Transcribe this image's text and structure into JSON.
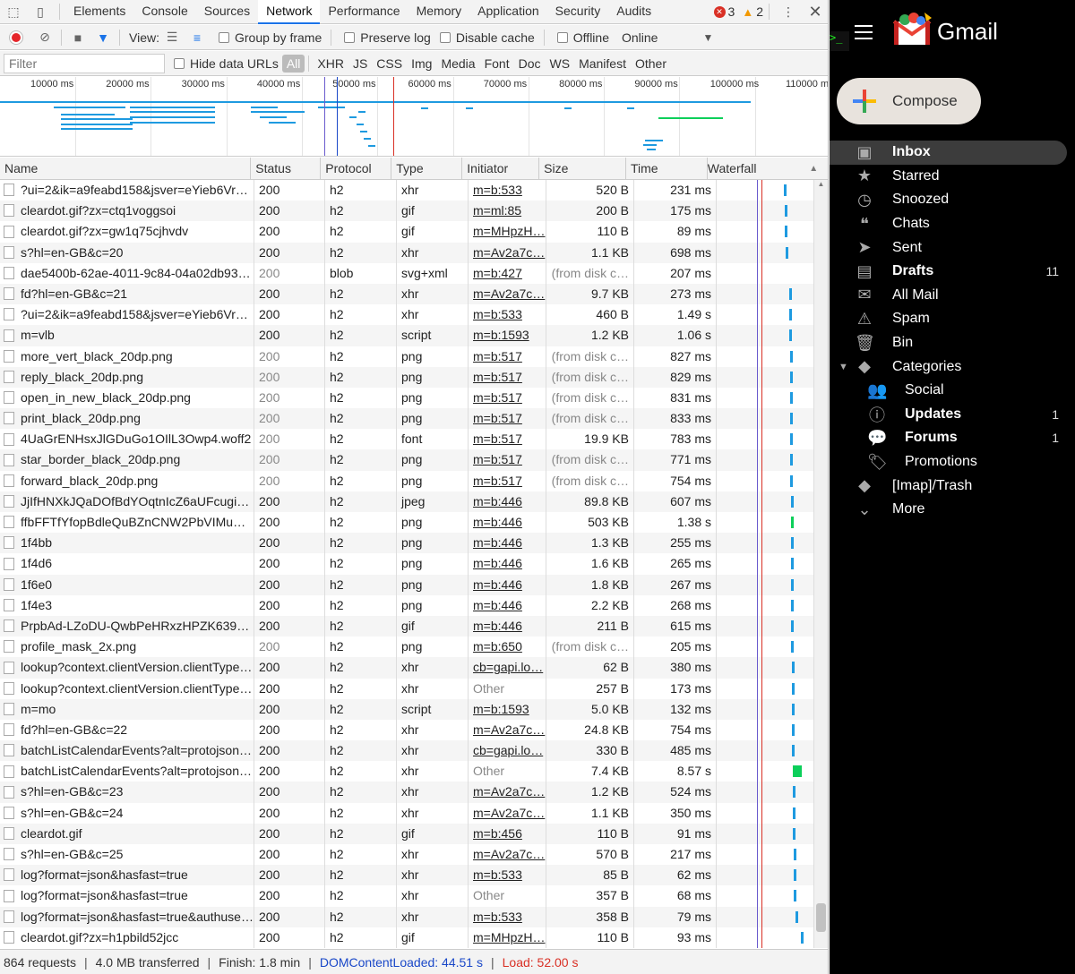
{
  "devtools": {
    "tabs": [
      "Elements",
      "Console",
      "Sources",
      "Network",
      "Performance",
      "Memory",
      "Application",
      "Security",
      "Audits"
    ],
    "active_tab": "Network",
    "error_count": "3",
    "warning_count": "2",
    "toolbar": {
      "view_label": "View:",
      "group_by_frame": "Group by frame",
      "preserve_log": "Preserve log",
      "disable_cache": "Disable cache",
      "offline": "Offline",
      "throttle": "Online"
    },
    "filter": {
      "placeholder": "Filter",
      "hide_data_urls": "Hide data URLs",
      "types": [
        "All",
        "XHR",
        "JS",
        "CSS",
        "Img",
        "Media",
        "Font",
        "Doc",
        "WS",
        "Manifest",
        "Other"
      ],
      "active_type": "All"
    },
    "overview_ticks": [
      "10000 ms",
      "20000 ms",
      "30000 ms",
      "40000 ms",
      "50000 ms",
      "60000 ms",
      "70000 ms",
      "80000 ms",
      "90000 ms",
      "100000 ms",
      "110000 m"
    ],
    "columns": [
      "Name",
      "Status",
      "Protocol",
      "Type",
      "Initiator",
      "Size",
      "Time",
      "Waterfall"
    ],
    "rows": [
      {
        "name": "?ui=2&ik=a9feabd158&jsver=eYieb6VrL…",
        "status": "200",
        "protocol": "h2",
        "type": "xhr",
        "initiator": "m=b:533",
        "size": "520 B",
        "time": "231 ms",
        "wf": 0.7,
        "dim": false
      },
      {
        "name": "cleardot.gif?zx=ctq1voggsoi",
        "status": "200",
        "protocol": "h2",
        "type": "gif",
        "initiator": "m=ml:85",
        "size": "200 B",
        "time": "175 ms",
        "wf": 0.71,
        "dim": false
      },
      {
        "name": "cleardot.gif?zx=gw1q75cjhvdv",
        "status": "200",
        "protocol": "h2",
        "type": "gif",
        "initiator": "m=MHpzH…",
        "size": "110 B",
        "time": "89 ms",
        "wf": 0.71,
        "dim": false
      },
      {
        "name": "s?hl=en-GB&c=20",
        "status": "200",
        "protocol": "h2",
        "type": "xhr",
        "initiator": "m=Av2a7c…",
        "size": "1.1 KB",
        "time": "698 ms",
        "wf": 0.72,
        "dim": false
      },
      {
        "name": "dae5400b-62ae-4011-9c84-04a02db93139",
        "status": "200",
        "protocol": "blob",
        "type": "svg+xml",
        "initiator": "m=b:427",
        "size": "(from disk c…",
        "time": "207 ms",
        "wf": null,
        "dim": true
      },
      {
        "name": "fd?hl=en-GB&c=21",
        "status": "200",
        "protocol": "h2",
        "type": "xhr",
        "initiator": "m=Av2a7c…",
        "size": "9.7 KB",
        "time": "273 ms",
        "wf": 0.75,
        "dim": false
      },
      {
        "name": "?ui=2&ik=a9feabd158&jsver=eYieb6VrL…",
        "status": "200",
        "protocol": "h2",
        "type": "xhr",
        "initiator": "m=b:533",
        "size": "460 B",
        "time": "1.49 s",
        "wf": 0.75,
        "dim": false
      },
      {
        "name": "m=vlb",
        "status": "200",
        "protocol": "h2",
        "type": "script",
        "initiator": "m=b:1593",
        "size": "1.2 KB",
        "time": "1.06 s",
        "wf": 0.75,
        "dim": false
      },
      {
        "name": "more_vert_black_20dp.png",
        "status": "200",
        "protocol": "h2",
        "type": "png",
        "initiator": "m=b:517",
        "size": "(from disk c…",
        "time": "827 ms",
        "wf": 0.76,
        "dim": true
      },
      {
        "name": "reply_black_20dp.png",
        "status": "200",
        "protocol": "h2",
        "type": "png",
        "initiator": "m=b:517",
        "size": "(from disk c…",
        "time": "829 ms",
        "wf": 0.76,
        "dim": true
      },
      {
        "name": "open_in_new_black_20dp.png",
        "status": "200",
        "protocol": "h2",
        "type": "png",
        "initiator": "m=b:517",
        "size": "(from disk c…",
        "time": "831 ms",
        "wf": 0.76,
        "dim": true
      },
      {
        "name": "print_black_20dp.png",
        "status": "200",
        "protocol": "h2",
        "type": "png",
        "initiator": "m=b:517",
        "size": "(from disk c…",
        "time": "833 ms",
        "wf": 0.76,
        "dim": true
      },
      {
        "name": "4UaGrENHsxJlGDuGo1OIlL3Owp4.woff2",
        "status": "200",
        "protocol": "h2",
        "type": "font",
        "initiator": "m=b:517",
        "size": "19.9 KB",
        "time": "783 ms",
        "wf": 0.76,
        "dim": true
      },
      {
        "name": "star_border_black_20dp.png",
        "status": "200",
        "protocol": "h2",
        "type": "png",
        "initiator": "m=b:517",
        "size": "(from disk c…",
        "time": "771 ms",
        "wf": 0.76,
        "dim": true
      },
      {
        "name": "forward_black_20dp.png",
        "status": "200",
        "protocol": "h2",
        "type": "png",
        "initiator": "m=b:517",
        "size": "(from disk c…",
        "time": "754 ms",
        "wf": 0.76,
        "dim": true
      },
      {
        "name": "JjIfHNXkJQaDOfBdYOqtnIcZ6aUFcugiR…",
        "status": "200",
        "protocol": "h2",
        "type": "jpeg",
        "initiator": "m=b:446",
        "size": "89.8 KB",
        "time": "607 ms",
        "wf": 0.77,
        "dim": false
      },
      {
        "name": "ffbFFTfYfopBdleQuBZnCNW2PbVIMuY…",
        "status": "200",
        "protocol": "h2",
        "type": "png",
        "initiator": "m=b:446",
        "size": "503 KB",
        "time": "1.38 s",
        "wf": 0.77,
        "dim": false
      },
      {
        "name": "1f4bb",
        "status": "200",
        "protocol": "h2",
        "type": "png",
        "initiator": "m=b:446",
        "size": "1.3 KB",
        "time": "255 ms",
        "wf": 0.77,
        "dim": false
      },
      {
        "name": "1f4d6",
        "status": "200",
        "protocol": "h2",
        "type": "png",
        "initiator": "m=b:446",
        "size": "1.6 KB",
        "time": "265 ms",
        "wf": 0.77,
        "dim": false
      },
      {
        "name": "1f6e0",
        "status": "200",
        "protocol": "h2",
        "type": "png",
        "initiator": "m=b:446",
        "size": "1.8 KB",
        "time": "267 ms",
        "wf": 0.77,
        "dim": false
      },
      {
        "name": "1f4e3",
        "status": "200",
        "protocol": "h2",
        "type": "png",
        "initiator": "m=b:446",
        "size": "2.2 KB",
        "time": "268 ms",
        "wf": 0.77,
        "dim": false
      },
      {
        "name": "PrpbAd-LZoDU-QwbPeHRxzHPZK639v…",
        "status": "200",
        "protocol": "h2",
        "type": "gif",
        "initiator": "m=b:446",
        "size": "211 B",
        "time": "615 ms",
        "wf": 0.77,
        "dim": false
      },
      {
        "name": "profile_mask_2x.png",
        "status": "200",
        "protocol": "h2",
        "type": "png",
        "initiator": "m=b:650",
        "size": "(from disk c…",
        "time": "205 ms",
        "wf": 0.77,
        "dim": true
      },
      {
        "name": "lookup?context.clientVersion.clientType=…",
        "status": "200",
        "protocol": "h2",
        "type": "xhr",
        "initiator": "cb=gapi.lo…",
        "size": "62 B",
        "time": "380 ms",
        "wf": 0.78,
        "dim": false
      },
      {
        "name": "lookup?context.clientVersion.clientType=…",
        "status": "200",
        "protocol": "h2",
        "type": "xhr",
        "initiator": "Other",
        "size": "257 B",
        "time": "173 ms",
        "wf": 0.78,
        "dim": false
      },
      {
        "name": "m=mo",
        "status": "200",
        "protocol": "h2",
        "type": "script",
        "initiator": "m=b:1593",
        "size": "5.0 KB",
        "time": "132 ms",
        "wf": 0.78,
        "dim": false
      },
      {
        "name": "fd?hl=en-GB&c=22",
        "status": "200",
        "protocol": "h2",
        "type": "xhr",
        "initiator": "m=Av2a7c…",
        "size": "24.8 KB",
        "time": "754 ms",
        "wf": 0.78,
        "dim": false
      },
      {
        "name": "batchListCalendarEvents?alt=protojson…",
        "status": "200",
        "protocol": "h2",
        "type": "xhr",
        "initiator": "cb=gapi.lo…",
        "size": "330 B",
        "time": "485 ms",
        "wf": 0.78,
        "dim": false
      },
      {
        "name": "batchListCalendarEvents?alt=protojson…",
        "status": "200",
        "protocol": "h2",
        "type": "xhr",
        "initiator": "Other",
        "size": "7.4 KB",
        "time": "8.57 s",
        "wf": 0.79,
        "dim": false
      },
      {
        "name": "s?hl=en-GB&c=23",
        "status": "200",
        "protocol": "h2",
        "type": "xhr",
        "initiator": "m=Av2a7c…",
        "size": "1.2 KB",
        "time": "524 ms",
        "wf": 0.79,
        "dim": false
      },
      {
        "name": "s?hl=en-GB&c=24",
        "status": "200",
        "protocol": "h2",
        "type": "xhr",
        "initiator": "m=Av2a7c…",
        "size": "1.1 KB",
        "time": "350 ms",
        "wf": 0.79,
        "dim": false
      },
      {
        "name": "cleardot.gif",
        "status": "200",
        "protocol": "h2",
        "type": "gif",
        "initiator": "m=b:456",
        "size": "110 B",
        "time": "91 ms",
        "wf": 0.79,
        "dim": false
      },
      {
        "name": "s?hl=en-GB&c=25",
        "status": "200",
        "protocol": "h2",
        "type": "xhr",
        "initiator": "m=Av2a7c…",
        "size": "570 B",
        "time": "217 ms",
        "wf": 0.8,
        "dim": false
      },
      {
        "name": "log?format=json&hasfast=true",
        "status": "200",
        "protocol": "h2",
        "type": "xhr",
        "initiator": "m=b:533",
        "size": "85 B",
        "time": "62 ms",
        "wf": 0.8,
        "dim": false
      },
      {
        "name": "log?format=json&hasfast=true",
        "status": "200",
        "protocol": "h2",
        "type": "xhr",
        "initiator": "Other",
        "size": "357 B",
        "time": "68 ms",
        "wf": 0.8,
        "dim": false
      },
      {
        "name": "log?format=json&hasfast=true&authuser=0",
        "status": "200",
        "protocol": "h2",
        "type": "xhr",
        "initiator": "m=b:533",
        "size": "358 B",
        "time": "79 ms",
        "wf": 0.82,
        "dim": false
      },
      {
        "name": "cleardot.gif?zx=h1pbild52jcc",
        "status": "200",
        "protocol": "h2",
        "type": "gif",
        "initiator": "m=MHpzH…",
        "size": "110 B",
        "time": "93 ms",
        "wf": 0.87,
        "dim": false
      }
    ],
    "status_bar": {
      "requests": "864 requests",
      "transferred": "4.0 MB transferred",
      "finish": "Finish: 1.8 min",
      "dom_content_loaded": "DOMContentLoaded: 44.51 s",
      "load": "Load: 52.00 s"
    }
  },
  "gmail": {
    "brand": "Gmail",
    "compose_label": "Compose",
    "nav": [
      {
        "label": "Inbox",
        "icon": "inbox-icon",
        "glyph": "▣",
        "count": "",
        "bold": true,
        "active": true,
        "sub": false
      },
      {
        "label": "Starred",
        "icon": "star-icon",
        "glyph": "★",
        "count": "",
        "bold": false,
        "active": false,
        "sub": false
      },
      {
        "label": "Snoozed",
        "icon": "clock-icon",
        "glyph": "◷",
        "count": "",
        "bold": false,
        "active": false,
        "sub": false
      },
      {
        "label": "Chats",
        "icon": "chat-icon",
        "glyph": "❝",
        "count": "",
        "bold": false,
        "active": false,
        "sub": false
      },
      {
        "label": "Sent",
        "icon": "send-icon",
        "glyph": "➤",
        "count": "",
        "bold": false,
        "active": false,
        "sub": false
      },
      {
        "label": "Drafts",
        "icon": "draft-icon",
        "glyph": "▤",
        "count": "11",
        "bold": true,
        "active": false,
        "sub": false
      },
      {
        "label": "All Mail",
        "icon": "mail-icon",
        "glyph": "✉",
        "count": "",
        "bold": false,
        "active": false,
        "sub": false
      },
      {
        "label": "Spam",
        "icon": "spam-icon",
        "glyph": "⚠",
        "count": "",
        "bold": false,
        "active": false,
        "sub": false
      },
      {
        "label": "Bin",
        "icon": "bin-icon",
        "glyph": "🗑",
        "count": "",
        "bold": false,
        "active": false,
        "sub": false
      },
      {
        "label": "Categories",
        "icon": "label-icon",
        "glyph": "◆",
        "count": "",
        "bold": false,
        "active": false,
        "sub": false,
        "caret": true
      },
      {
        "label": "Social",
        "icon": "people-icon",
        "glyph": "👥",
        "count": "",
        "bold": false,
        "active": false,
        "sub": true
      },
      {
        "label": "Updates",
        "icon": "info-icon",
        "glyph": "ⓘ",
        "count": "1",
        "bold": true,
        "active": false,
        "sub": true
      },
      {
        "label": "Forums",
        "icon": "forum-icon",
        "glyph": "💬",
        "count": "1",
        "bold": true,
        "active": false,
        "sub": true
      },
      {
        "label": "Promotions",
        "icon": "tag-icon",
        "glyph": "🏷",
        "count": "",
        "bold": false,
        "active": false,
        "sub": true
      },
      {
        "label": "[Imap]/Trash",
        "icon": "label-icon",
        "glyph": "◆",
        "count": "",
        "bold": false,
        "active": false,
        "sub": false
      },
      {
        "label": "More",
        "icon": "chevron-down-icon",
        "glyph": "⌄",
        "count": "",
        "bold": false,
        "active": false,
        "sub": false
      }
    ]
  }
}
